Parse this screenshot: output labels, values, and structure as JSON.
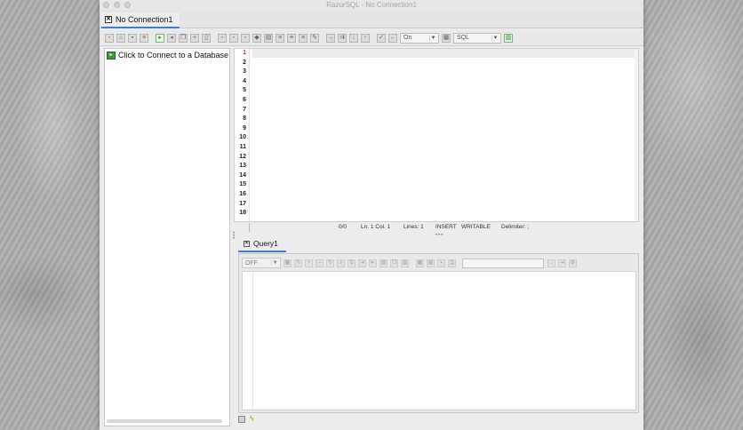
{
  "window": {
    "title": "RazorSQL - No Connection1"
  },
  "connection_tab": {
    "label": "No Connection1",
    "close_glyph": "✕"
  },
  "toolbar": {
    "icons_group1": [
      "new-file-icon",
      "open-folder-icon",
      "save-icon",
      "properties-icon"
    ],
    "icons_group2": [
      "connect-icon",
      "disconnect-icon",
      "copy-icon",
      "add-connection-icon",
      "clipboard-icon"
    ],
    "icons_group3": [
      "copy-text-icon",
      "copy-formatted-icon",
      "paste-icon",
      "clear-icon",
      "format-icon",
      "comment-icon",
      "uncomment-icon",
      "indent-icon",
      "note-icon"
    ],
    "icons_group4": [
      "run-icon",
      "run-all-icon",
      "step-down-icon",
      "step-up-icon",
      "check-icon",
      "back-icon"
    ],
    "autocommit_value": "On",
    "language_value": "SQL"
  },
  "left_panel": {
    "connect_link": "Click to Connect to a Database"
  },
  "editor": {
    "line_numbers": [
      "1",
      "2",
      "3",
      "4",
      "5",
      "6",
      "7",
      "8",
      "9",
      "10",
      "11",
      "12",
      "13",
      "14",
      "15",
      "16",
      "17",
      "18"
    ],
    "current_line": 1
  },
  "statusbar": {
    "position": "0/0",
    "cursor": "Ln. 1 Col. 1",
    "lines": "Lines: 1",
    "mode": "INSERT",
    "writable": "WRITABLE",
    "delimiter": "Delimiter: ;"
  },
  "query_tab": {
    "label": "Query1",
    "close_glyph": "✕"
  },
  "results_toolbar": {
    "paging_value": "OFF",
    "icons": [
      "table-icon",
      "edit-icon",
      "add-row-icon",
      "delete-row-icon",
      "refresh-icon",
      "filter-icon",
      "sort-icon",
      "export-icon",
      "import-icon",
      "chart-icon",
      "copy-icon",
      "columns-icon",
      "grid-icon",
      "text-icon",
      "save-icon",
      "print-icon"
    ]
  }
}
